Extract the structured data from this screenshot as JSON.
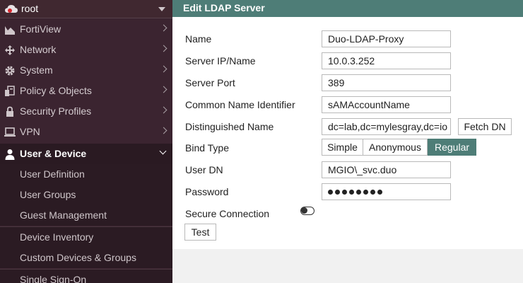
{
  "sidebar": {
    "vdom": "root",
    "items": [
      {
        "label": "FortiView",
        "icon": "chart-icon"
      },
      {
        "label": "Network",
        "icon": "network-icon"
      },
      {
        "label": "System",
        "icon": "gear-icon"
      },
      {
        "label": "Policy & Objects",
        "icon": "policy-icon"
      },
      {
        "label": "Security Profiles",
        "icon": "lock-icon"
      },
      {
        "label": "VPN",
        "icon": "monitor-icon"
      },
      {
        "label": "User & Device",
        "icon": "user-icon",
        "active": true
      }
    ],
    "subitems": [
      "User Definition",
      "User Groups",
      "Guest Management",
      "Device Inventory",
      "Custom Devices & Groups",
      "Single Sign-On"
    ]
  },
  "panel": {
    "title": "Edit LDAP Server"
  },
  "form": {
    "name_label": "Name",
    "name_value": "Duo-LDAP-Proxy",
    "server_label": "Server IP/Name",
    "server_value": "10.0.3.252",
    "port_label": "Server Port",
    "port_value": "389",
    "cn_label": "Common Name Identifier",
    "cn_value": "sAMAccountName",
    "dn_label": "Distinguished Name",
    "dn_value": "dc=lab,dc=mylesgray,dc=io",
    "fetch_dn": "Fetch DN",
    "bind_label": "Bind Type",
    "bind_options": [
      "Simple",
      "Anonymous",
      "Regular"
    ],
    "bind_selected": "Regular",
    "userdn_label": "User DN",
    "userdn_value": "MGIO\\_svc.duo",
    "password_label": "Password",
    "password_mask_count": 8,
    "secure_label": "Secure Connection",
    "secure_enabled": false,
    "test_label": "Test"
  },
  "colors": {
    "sidebar_bg": "#3b2430",
    "accent": "#4e7d77"
  }
}
